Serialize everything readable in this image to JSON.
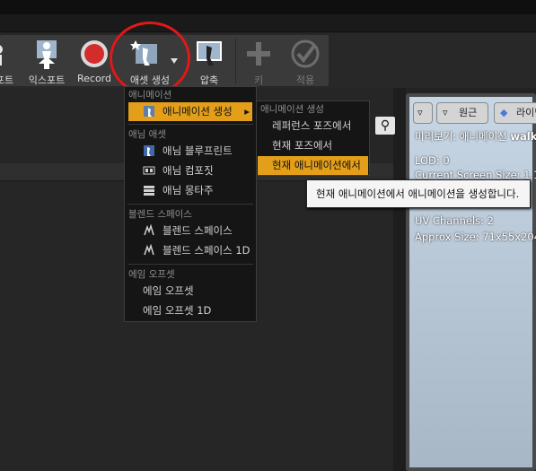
{
  "toolbar": {
    "partial_label": "포트",
    "export_label": "익스포트",
    "record_label": "Record",
    "create_asset_label": "애셋 생성",
    "compress_label": "압축",
    "key_label": "키",
    "apply_label": "적용"
  },
  "menu": {
    "section_animation": "애니메이션",
    "create_animation": "애니메이션 생성",
    "section_anim_asset": "애님 애셋",
    "anim_blueprint": "애님 블루프린트",
    "anim_composite": "애님 컴포짓",
    "anim_montage": "애님 몽타주",
    "section_blend_space": "블렌드 스페이스",
    "blend_space": "블렌드 스페이스",
    "blend_space_1d": "블렌드 스페이스 1D",
    "section_aim_offset": "에임 오프셋",
    "aim_offset": "에임 오프셋",
    "aim_offset_1d": "에임 오프셋 1D"
  },
  "submenu": {
    "header": "애니메이션 생성",
    "from_reference_pose": "레퍼런스 포즈에서",
    "from_current_pose": "현재 포즈에서",
    "from_current_animation": "현재 애니메이션에서"
  },
  "tooltip": {
    "text": "현재 애니메이션에서 애니메이션을 생성합니다."
  },
  "viewport": {
    "perspective_label": "원근",
    "lighting_label": "라이팅",
    "preview_prefix": "미리보기: 애니메이션",
    "preview_name": "walkf",
    "lod": "LOD: 0",
    "screen_size": "Current Screen Size: 1.1",
    "uv_channels": "UV Channels: 2",
    "approx_size": "Approx Size: 71x55x204"
  },
  "colors": {
    "highlight": "#e39f1a",
    "annotation_circle": "#e01818"
  }
}
